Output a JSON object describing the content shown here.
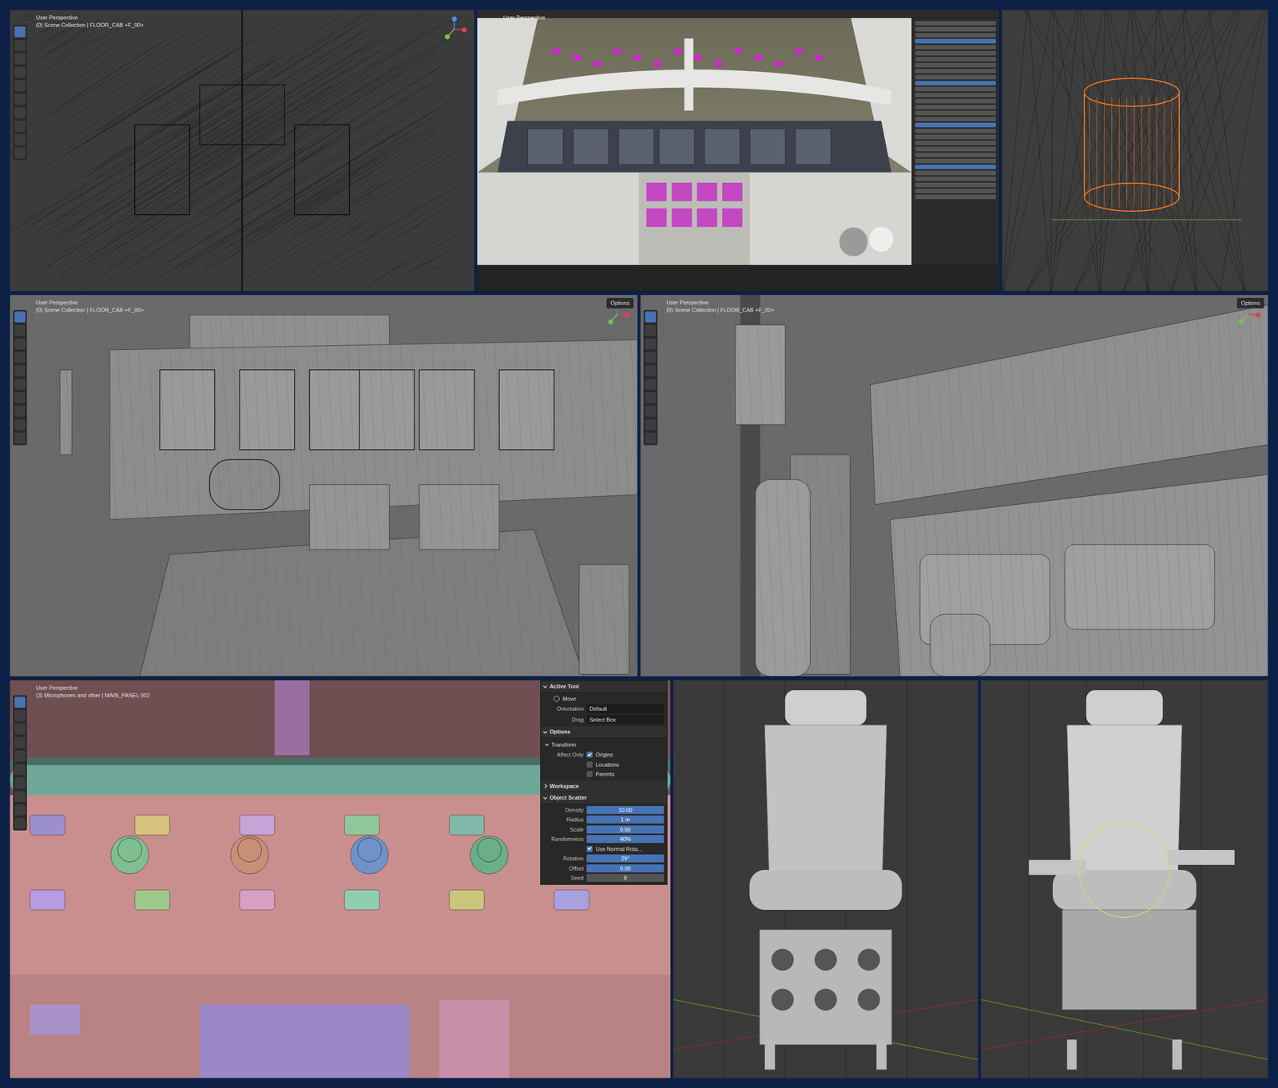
{
  "panels": [
    {
      "kind": "wireframe",
      "header": [
        "User Perspective",
        "(0) Scene Collection | FLOOR_CAB +F_00>"
      ],
      "options": ""
    },
    {
      "kind": "render",
      "header": [
        "User Perspective"
      ],
      "options": ""
    },
    {
      "kind": "wire-select",
      "header": [],
      "options": ""
    },
    {
      "kind": "cockpit",
      "header": [
        "User Perspective",
        "(0) Scene Collection | FLOOR_CAB +F_00>"
      ],
      "options": "Options"
    },
    {
      "kind": "side",
      "header": [
        "User Perspective",
        "(0) Scene Collection | FLOOR_CAB +F_00>"
      ],
      "options": "Options"
    },
    {
      "kind": "closeup",
      "header": [
        "User Perspective",
        "(3) Microphones and other | MAIN_PANEL 002"
      ],
      "options": ""
    },
    {
      "kind": "seat-back",
      "header": [],
      "options": ""
    },
    {
      "kind": "seat-front",
      "header": [],
      "options": ""
    }
  ],
  "keys": [
    {
      "color": "#9b8fd0"
    },
    {
      "color": "#d8c27e"
    },
    {
      "color": "#c7a3d8"
    },
    {
      "color": "#8fc79a"
    },
    {
      "color": "#7fb8a8"
    },
    {
      "color": "#d9c07c"
    },
    {
      "color": "#b99be0"
    },
    {
      "color": "#9fc98a"
    },
    {
      "color": "#d7a0c4"
    },
    {
      "color": "#8fcfb0"
    },
    {
      "color": "#c9c57c"
    },
    {
      "color": "#a9a0e0"
    }
  ],
  "knobs": [
    {
      "color": "#7fbf8f"
    },
    {
      "color": "#c98e78"
    },
    {
      "color": "#6f92c9"
    },
    {
      "color": "#6aaf8a"
    }
  ],
  "sidebar": {
    "sections": [
      {
        "title": "Active Tool",
        "expanded": true,
        "rows": [
          {
            "kind": "tool",
            "label": "",
            "value": "Move",
            "checked": false,
            "level": 0
          },
          {
            "kind": "dropdown",
            "label": "Orientation",
            "value": "Default",
            "checked": false,
            "level": 0
          },
          {
            "kind": "dropdown",
            "label": "Drag",
            "value": "Select Box",
            "checked": false,
            "level": 0
          }
        ]
      },
      {
        "title": "Options",
        "expanded": true,
        "rows": [
          {
            "kind": "subheader",
            "label": "",
            "value": "Transform",
            "checked": false,
            "level": 0
          },
          {
            "kind": "checkbox",
            "label": "Affect Only",
            "value": "Origins",
            "checked": true,
            "level": 0
          },
          {
            "kind": "checkbox",
            "label": "",
            "value": "Locations",
            "checked": false,
            "level": 0
          },
          {
            "kind": "checkbox",
            "label": "",
            "value": "Parents",
            "checked": false,
            "level": 0
          }
        ]
      },
      {
        "title": "Workspace",
        "expanded": false,
        "rows": []
      },
      {
        "title": "Object Scatter",
        "expanded": true,
        "rows": [
          {
            "kind": "slider",
            "label": "Density",
            "value": "10.00",
            "checked": false,
            "level": 1
          },
          {
            "kind": "slider",
            "label": "Radius",
            "value": "1 m",
            "checked": false,
            "level": 1
          },
          {
            "kind": "slider",
            "label": "Scale",
            "value": "0.50",
            "checked": false,
            "level": 1
          },
          {
            "kind": "slider",
            "label": "Randomness",
            "value": "40%",
            "checked": false,
            "level": 1
          },
          {
            "kind": "checkbox",
            "label": "",
            "value": "Use Normal Rota...",
            "checked": true,
            "level": 0
          },
          {
            "kind": "slider",
            "label": "Rotation",
            "value": "29°",
            "checked": false,
            "level": 1
          },
          {
            "kind": "slider",
            "label": "Offset",
            "value": "0.00",
            "checked": false,
            "level": 1
          },
          {
            "kind": "slider",
            "label": "Seed",
            "value": "0",
            "checked": false,
            "level": 0
          }
        ]
      }
    ]
  }
}
